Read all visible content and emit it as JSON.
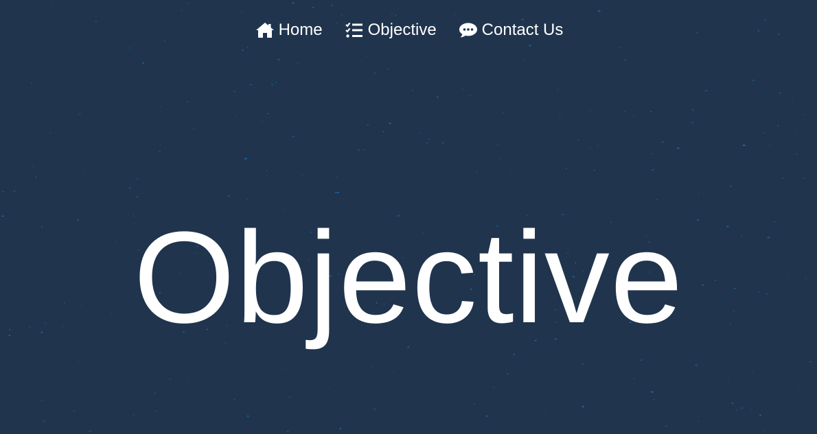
{
  "nav": {
    "items": [
      {
        "label": "Home",
        "icon": "home-icon"
      },
      {
        "label": "Objective",
        "icon": "tasks-icon"
      },
      {
        "label": "Contact Us",
        "icon": "comment-icon"
      }
    ]
  },
  "hero": {
    "title": "Objective"
  },
  "colors": {
    "background": "#20344d",
    "text": "#ffffff",
    "speck": "#1b6fa8"
  }
}
